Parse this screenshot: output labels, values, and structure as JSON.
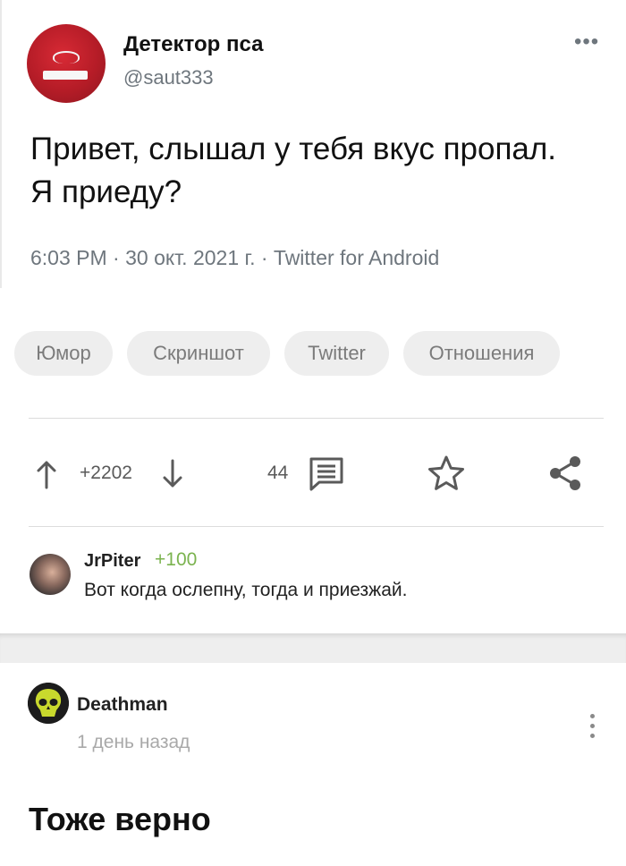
{
  "tweet": {
    "display_name": "Детектор пса",
    "handle": "@saut333",
    "more": "•••",
    "text": "Привет, слышал у тебя вкус пропал. Я приеду?",
    "meta": "6:03 PM · 30 окт. 2021 г. · Twitter for Android"
  },
  "tags": [
    "Юмор",
    "Скриншот",
    "Twitter",
    "Отношения"
  ],
  "actions": {
    "rating": "+2202",
    "comments": "44",
    "icons": [
      "arrow-up-icon",
      "arrow-down-icon",
      "comment-icon",
      "star-icon",
      "share-icon"
    ]
  },
  "top_comment": {
    "author": "JrPiter",
    "rating": "+100",
    "text": "Вот когда ослепну, тогда и приезжай."
  },
  "next_post": {
    "author": "Deathman",
    "time": "1 день назад",
    "title": "Тоже верно"
  },
  "colors": {
    "tag_bg": "#eeeeee",
    "positive": "#7bb34f",
    "muted": "#6e767d"
  }
}
